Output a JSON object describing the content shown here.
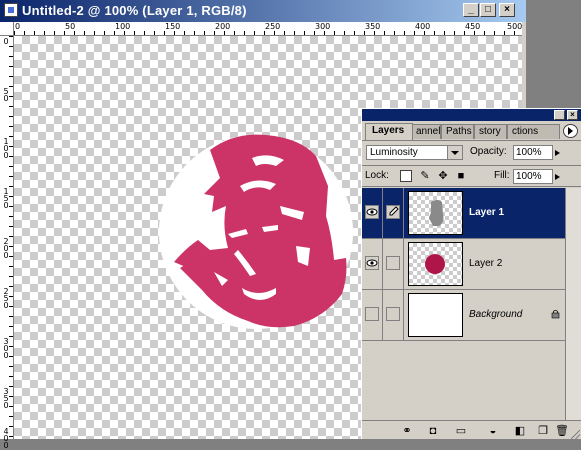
{
  "window": {
    "title": "Untitled-2 @ 100% (Layer 1, RGB/8)",
    "controls": {
      "minimize": "_",
      "maximize": "□",
      "close": "×"
    }
  },
  "rulers": {
    "top_labels": [
      "0",
      "50",
      "100",
      "150",
      "200",
      "250",
      "300",
      "350",
      "400",
      "450",
      "500"
    ],
    "left_labels": [
      "0",
      "50",
      "100",
      "150",
      "200",
      "250",
      "300",
      "350",
      "400"
    ]
  },
  "canvas": {
    "accent_color": "#cc3366"
  },
  "layers_panel": {
    "tabs": [
      {
        "label": "Layers",
        "active": true
      },
      {
        "label": "annels",
        "active": false
      },
      {
        "label": "Paths",
        "active": false
      },
      {
        "label": "story",
        "active": false
      },
      {
        "label": "ctions",
        "active": false
      }
    ],
    "blend_mode": "Luminosity",
    "opacity_label": "Opacity:",
    "opacity_value": "100%",
    "lock_label": "Lock:",
    "fill_label": "Fill:",
    "fill_value": "100%",
    "layers": [
      {
        "name": "Layer 1",
        "visible": true,
        "selected": true,
        "linked_icon": "brush-icon"
      },
      {
        "name": "Layer 2",
        "visible": true,
        "selected": false
      },
      {
        "name": "Background",
        "visible": false,
        "selected": false,
        "locked": true
      }
    ],
    "bottom_icons": [
      "link-icon",
      "layer-style-icon",
      "mask-icon",
      "new-set-icon",
      "adjustment-layer-icon",
      "new-layer-icon",
      "trash-icon"
    ]
  }
}
